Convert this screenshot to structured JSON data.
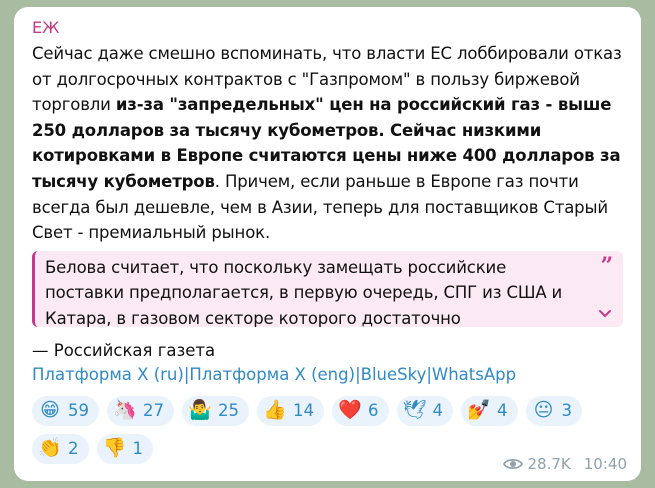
{
  "message": {
    "sender": "ЕЖ",
    "body_part1": "Сейчас даже смешно вспоминать, что власти ЕС лоббировали отказ от долгосрочных контрактов с \"Газпромом\" в пользу биржевой торговли ",
    "body_bold": "из-за \"запредельных\" цен на российский газ - выше 250 долларов за тысячу кубометров. Сейчас низкими котировками в Европе считаются цены ниже 400 долларов за тысячу кубометров",
    "body_part2": ". Причем, если раньше в Европе газ почти всегда был дешевле, чем в Азии, теперь для поставщиков Старый Свет - премиальный рынок.",
    "quote": "Белова считает, что поскольку замещать российские поставки предполагается, в первую очередь, СПГ из США и Катара, в газовом секторе которого достаточно",
    "quote_mark": "”",
    "source": "— Российская газета",
    "links": [
      {
        "label": "Платформа X (ru)"
      },
      {
        "label": "Платформа X (eng)"
      },
      {
        "label": "BlueSky"
      },
      {
        "label": "WhatsApp"
      }
    ],
    "link_separator": "|"
  },
  "reactions": [
    {
      "emoji": "😁",
      "icon": "grinning-face-icon",
      "count": "59"
    },
    {
      "emoji": "🦄",
      "icon": "unicorn-icon",
      "count": "27"
    },
    {
      "emoji": "🤷‍♂️",
      "icon": "shrug-icon",
      "count": "25"
    },
    {
      "emoji": "👍",
      "icon": "thumbs-up-icon",
      "count": "14"
    },
    {
      "emoji": "❤️",
      "icon": "heart-icon",
      "count": "6"
    },
    {
      "emoji": "🕊",
      "icon": "dove-icon",
      "count": "4"
    },
    {
      "emoji": "💅",
      "icon": "nail-polish-icon",
      "count": "4"
    },
    {
      "emoji": "😐",
      "icon": "neutral-face-icon",
      "count": "3"
    },
    {
      "emoji": "👏",
      "icon": "clapping-hands-icon",
      "count": "2"
    },
    {
      "emoji": "👎",
      "icon": "thumbs-down-icon",
      "count": "1"
    }
  ],
  "footer": {
    "views": "28.7K",
    "time": "10:40"
  },
  "colors": {
    "sender": "#c5398a",
    "link": "#2f8ac6",
    "quote_bg": "#fbeaf3",
    "reaction_bg": "#eaf3fb",
    "meta": "#8fa2ae",
    "chat_bg": "#a9bba0"
  }
}
